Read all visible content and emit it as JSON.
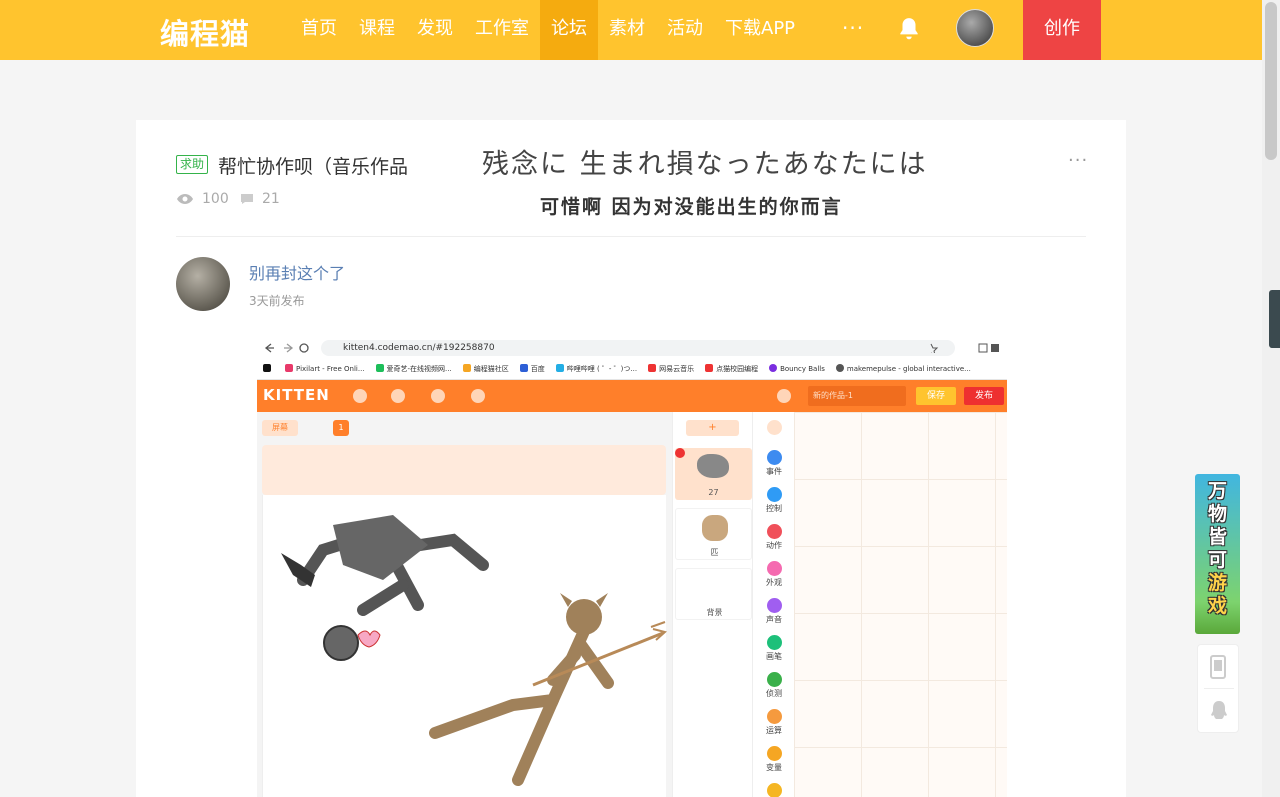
{
  "header": {
    "logo": "编程猫",
    "nav": [
      "首页",
      "课程",
      "发现",
      "工作室",
      "论坛",
      "素材",
      "活动",
      "下载APP"
    ],
    "more": "···",
    "create_label": "创作",
    "accent_color": "#ffc42e",
    "active_color": "#f5ab0f",
    "create_color": "#ee4444"
  },
  "post": {
    "tag": "求助",
    "title": "帮忙协作呗（音乐作品",
    "views": "100",
    "comments": "21",
    "more": "···",
    "overlay_line1": "残念に 生まれ損なったあなたには",
    "overlay_line2": "可惜啊 因为对没能出生的你而言",
    "author": "别再封这个了",
    "time": "3天前发布"
  },
  "screenshot": {
    "url": "kitten4.codemao.cn/#192258870",
    "bookmarks": [
      "Pixilart - Free Onli...",
      "爱奇艺-在线视频网...",
      "编程猫社区",
      "百度",
      "哔哩哔哩 ( ゜- ゜)つ...",
      "网易云音乐",
      "点猫校园编程",
      "Bouncy Balls",
      "makemepulse - global interactive..."
    ],
    "app_name": "KITTEN",
    "work_name": "新的作品-1",
    "save": "保存",
    "publish": "发布",
    "screen_tab": "屏幕",
    "screen_num": "1",
    "add": "+",
    "sprites": [
      {
        "label": "27"
      },
      {
        "label": "匹"
      },
      {
        "label": "背景"
      }
    ],
    "blocks": [
      "事件",
      "控制",
      "动作",
      "外观",
      "声音",
      "画笔",
      "侦测",
      "运算",
      "变量"
    ],
    "block_colors": [
      "#3d8bf0",
      "#2f9bf5",
      "#f0505a",
      "#f56ab0",
      "#a05ef0",
      "#1dc07a",
      "#3ab04a",
      "#f59a3e",
      "#f5a623"
    ]
  },
  "ad": {
    "text": [
      "万",
      "物",
      "皆",
      "可",
      "游",
      "戏"
    ]
  }
}
